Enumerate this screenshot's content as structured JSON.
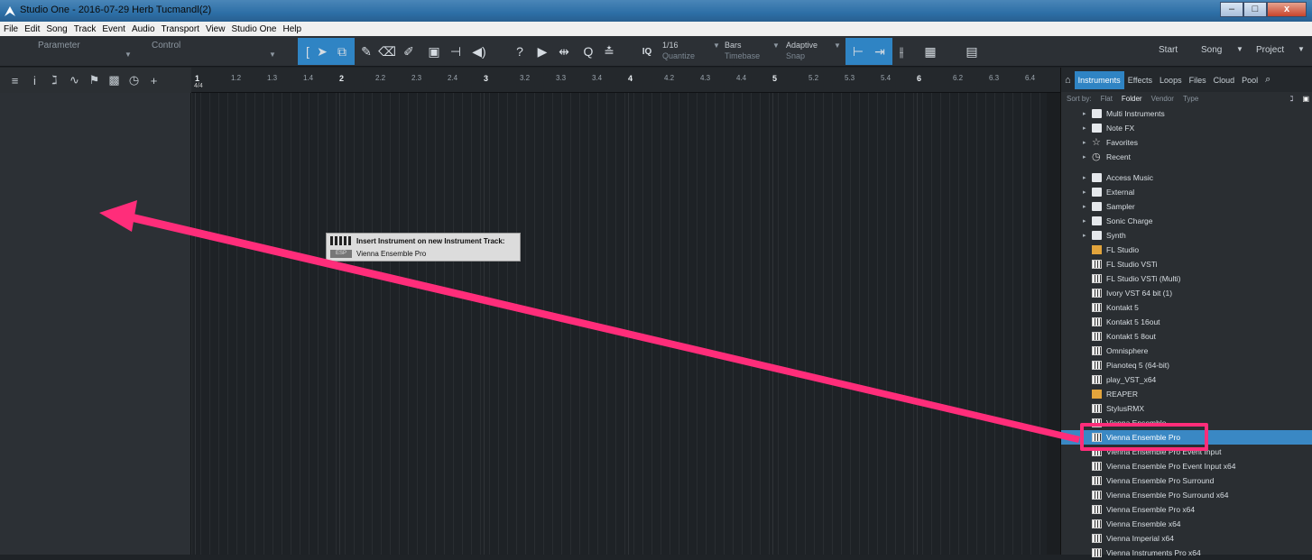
{
  "window": {
    "title": "Studio One - 2016-07-29 Herb Tucmandl(2)",
    "min": "–",
    "max": "□",
    "close": "x"
  },
  "menu": [
    "File",
    "Edit",
    "Song",
    "Track",
    "Event",
    "Audio",
    "Transport",
    "View",
    "Studio One",
    "Help"
  ],
  "toolbar": {
    "parameter": "Parameter",
    "control": "Control",
    "iq": "IQ",
    "quantize": {
      "value": "1/16",
      "label": "Quantize"
    },
    "timebase": {
      "value": "Bars",
      "label": "Timebase"
    },
    "snap": {
      "value": "Adaptive",
      "label": "Snap"
    },
    "right": {
      "start": "Start",
      "song": "Song",
      "project": "Project"
    }
  },
  "ruler": {
    "timesig": "4/4",
    "ticks": [
      "1",
      "1.2",
      "1.3",
      "1.4",
      "2",
      "2.2",
      "2.3",
      "2.4",
      "3",
      "3.2",
      "3.3",
      "3.4",
      "4",
      "4.2",
      "4.3",
      "4.4",
      "5",
      "5.2",
      "5.3",
      "5.4",
      "6",
      "6.2",
      "6.3",
      "6.4"
    ]
  },
  "tooltip": {
    "title": "Insert Instrument on new Instrument Track:",
    "subtitle": "Vienna Ensemble Pro",
    "icon_text": "ESP"
  },
  "browser": {
    "tabs": [
      "Instruments",
      "Effects",
      "Loops",
      "Files",
      "Cloud",
      "Pool"
    ],
    "sort": {
      "label": "Sort by:",
      "options": [
        "Flat",
        "Folder",
        "Vendor",
        "Type"
      ],
      "active": "Folder"
    },
    "items": [
      {
        "label": "Multi Instruments",
        "icon": "multi-folder-icon",
        "arrow": "▸"
      },
      {
        "label": "Note FX",
        "icon": "notefx-folder-icon",
        "arrow": "▸"
      },
      {
        "label": "Favorites",
        "icon": "star-icon",
        "arrow": "▸"
      },
      {
        "label": "Recent",
        "icon": "clock-icon",
        "arrow": "▸"
      },
      {
        "label": "Access Music",
        "icon": "folder-icon",
        "arrow": "▸"
      },
      {
        "label": "External",
        "icon": "folder-icon",
        "arrow": "▸"
      },
      {
        "label": "Sampler",
        "icon": "folder-icon",
        "arrow": "▸"
      },
      {
        "label": "Sonic Charge",
        "icon": "folder-icon",
        "arrow": "▸"
      },
      {
        "label": "Synth",
        "icon": "folder-icon",
        "arrow": "▸"
      },
      {
        "label": "FL Studio",
        "icon": "fx-x-icon"
      },
      {
        "label": "FL Studio VSTi",
        "icon": "keyboard-icon"
      },
      {
        "label": "FL Studio VSTi (Multi)",
        "icon": "keyboard-icon"
      },
      {
        "label": "Ivory VST 64 bit (1)",
        "icon": "keyboard-icon"
      },
      {
        "label": "Kontakt 5",
        "icon": "keyboard-icon"
      },
      {
        "label": "Kontakt 5 16out",
        "icon": "keyboard-icon"
      },
      {
        "label": "Kontakt 5 8out",
        "icon": "keyboard-icon"
      },
      {
        "label": "Omnisphere",
        "icon": "keyboard-icon"
      },
      {
        "label": "Pianoteq 5 (64-bit)",
        "icon": "keyboard-icon"
      },
      {
        "label": "play_VST_x64",
        "icon": "keyboard-icon"
      },
      {
        "label": "REAPER",
        "icon": "fx-x-icon"
      },
      {
        "label": "StylusRMX",
        "icon": "keyboard-icon"
      },
      {
        "label": "Vienna Ensemble",
        "icon": "keyboard-icon"
      },
      {
        "label": "Vienna Ensemble Pro",
        "icon": "keyboard-icon",
        "selected": true
      },
      {
        "label": "Vienna Ensemble Pro Event Input",
        "icon": "keyboard-icon"
      },
      {
        "label": "Vienna Ensemble Pro Event Input x64",
        "icon": "keyboard-icon"
      },
      {
        "label": "Vienna Ensemble Pro Surround",
        "icon": "keyboard-icon"
      },
      {
        "label": "Vienna Ensemble Pro Surround x64",
        "icon": "keyboard-icon"
      },
      {
        "label": "Vienna Ensemble Pro x64",
        "icon": "keyboard-icon"
      },
      {
        "label": "Vienna Ensemble x64",
        "icon": "keyboard-icon"
      },
      {
        "label": "Vienna Imperial x64",
        "icon": "keyboard-icon"
      },
      {
        "label": "Vienna Instruments Pro x64",
        "icon": "keyboard-icon"
      }
    ]
  },
  "colors": {
    "accent": "#2f84c4",
    "annotation": "#ff2d7a"
  }
}
